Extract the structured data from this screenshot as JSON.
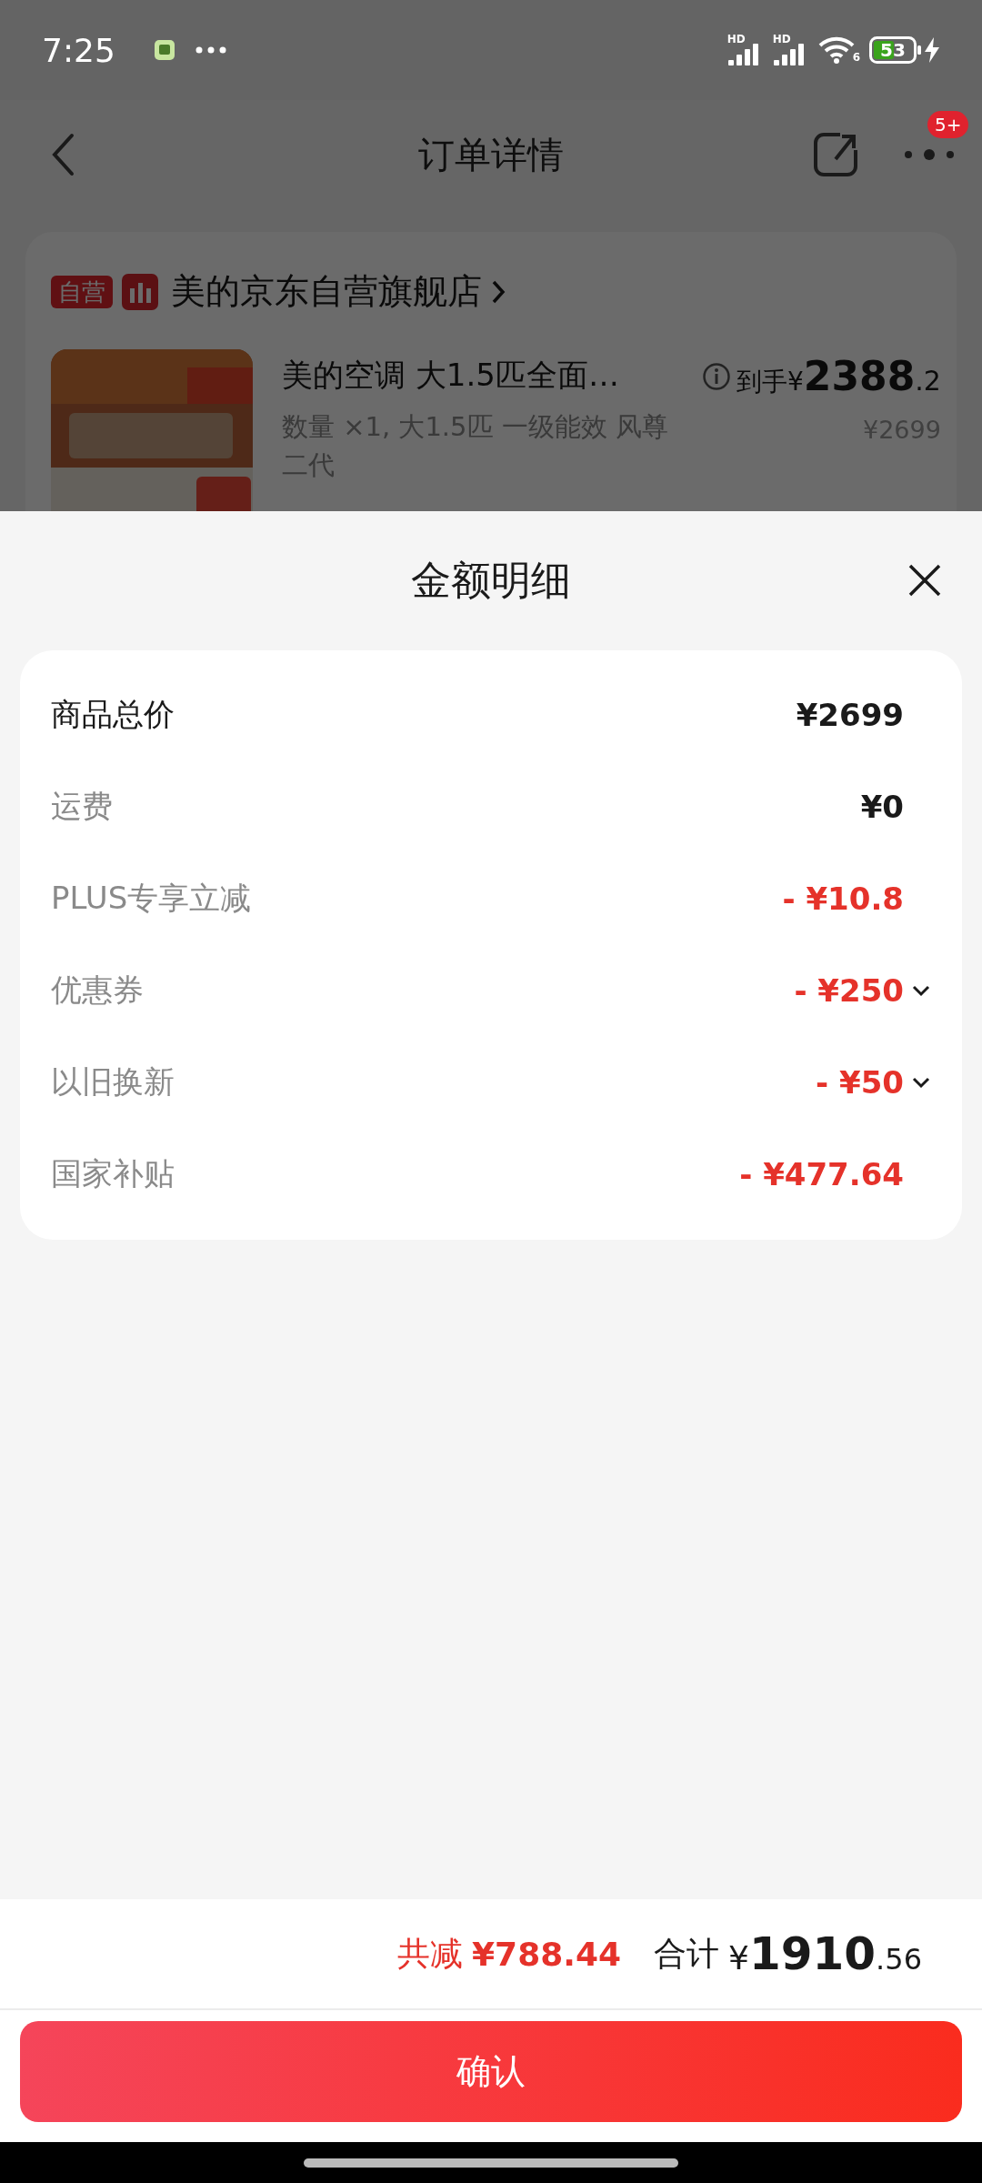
{
  "status_bar": {
    "time": "7:25",
    "signal_labels": [
      "HD",
      "HD"
    ],
    "wifi_label": "6",
    "battery": "53"
  },
  "header": {
    "title": "订单详情",
    "badge": "5+"
  },
  "store": {
    "tag": "自营",
    "name": "美的京东自营旗舰店"
  },
  "product": {
    "title": "美的空调 大1.5匹全面…",
    "spec": "数量 ×1, 大1.5匹 一级能效 风尊二代",
    "price": {
      "prefix": "到手¥",
      "integer": "2388",
      "decimal": ".2"
    },
    "original_price": "¥2699"
  },
  "sheet": {
    "title": "金额明细",
    "rows": [
      {
        "label": "商品总价",
        "value": "¥2699",
        "kind": "total",
        "expandable": false
      },
      {
        "label": "运费",
        "value": "¥0",
        "kind": "plain",
        "expandable": false
      },
      {
        "label": "PLUS专享立减",
        "value": "- ¥10.8",
        "kind": "deduction",
        "expandable": false
      },
      {
        "label": "优惠券",
        "value": "- ¥250",
        "kind": "deduction",
        "expandable": true
      },
      {
        "label": "以旧换新",
        "value": "- ¥50",
        "kind": "deduction",
        "expandable": true
      },
      {
        "label": "国家补贴",
        "value": "- ¥477.64",
        "kind": "deduction",
        "expandable": false
      }
    ]
  },
  "summary": {
    "saved_label": "共减",
    "saved_amount": "¥788.44",
    "total_label": "合计",
    "total": {
      "prefix": "¥",
      "integer": "1910",
      "decimal": ".56"
    }
  },
  "confirm_button": "确认"
}
